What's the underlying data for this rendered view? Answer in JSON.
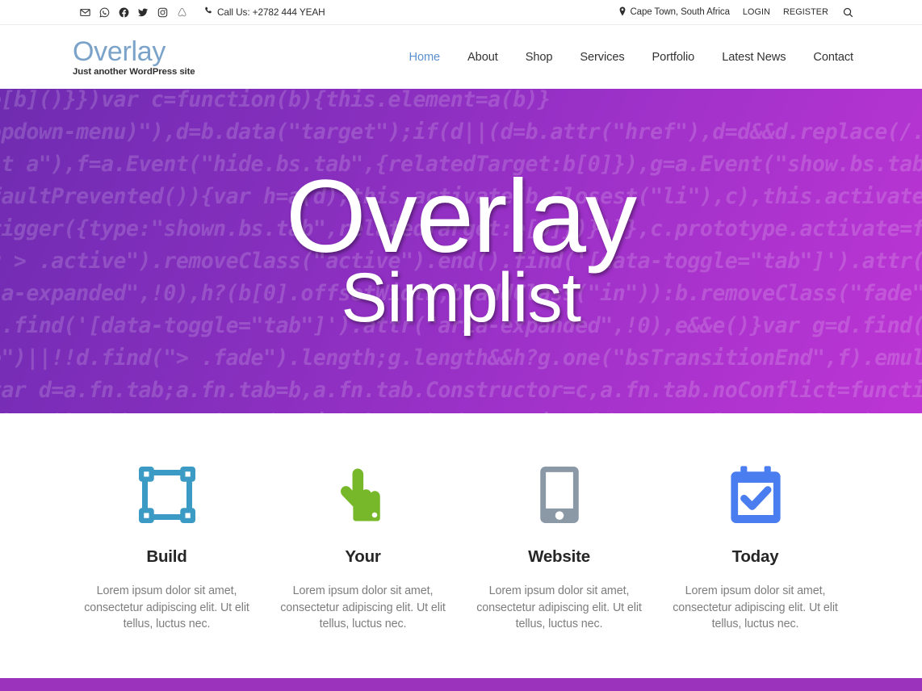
{
  "topbar": {
    "social": [
      {
        "name": "email-icon",
        "label": "Email"
      },
      {
        "name": "whatsapp-icon",
        "label": "WhatsApp"
      },
      {
        "name": "facebook-icon",
        "label": "Facebook"
      },
      {
        "name": "twitter-icon",
        "label": "Twitter"
      },
      {
        "name": "instagram-icon",
        "label": "Instagram"
      },
      {
        "name": "airbnb-icon",
        "label": "Airbnb"
      }
    ],
    "phone": "Call Us: +2782 444 YEAH",
    "location": "Cape Town, South Africa",
    "login": "LOGIN",
    "register": "REGISTER",
    "search_label": "Search"
  },
  "brand": {
    "title": "Overlay",
    "tagline": "Just another WordPress site",
    "color": "#7ba3c9"
  },
  "nav": {
    "items": [
      {
        "label": "Home",
        "active": true
      },
      {
        "label": "About",
        "active": false
      },
      {
        "label": "Shop",
        "active": false
      },
      {
        "label": "Services",
        "active": false
      },
      {
        "label": "Portfolio",
        "active": false
      },
      {
        "label": "Latest News",
        "active": false
      },
      {
        "label": "Contact",
        "active": false
      }
    ]
  },
  "hero": {
    "title": "Overlay",
    "subtitle": "Simplist",
    "gradient_from": "#6f2cb0",
    "gradient_to": "#bc35d4",
    "background_code": "e[b]()}})var c=function(b){this.element=a(b)}\nopdown-menu)\"),d=b.data(\"target\");if(d||(d=b.attr(\"href\"),d=d&&d.replace(/.*(?=#[^\\s]*$)/,\"\"))\nst a\"),f=a.Event(\"hide.bs.tab\",{relatedTarget:b[0]}),g=a.Event(\"show.bs.tab\",{relatedTarget:e[0]\nfaultPrevented()){var h=a(d);this.activate(b.closest(\"li\"),c),this.activate(h,h.parent(),functio\nrigger({type:\"shown.bs.tab\",relatedTarget:e[0]})})}},c.prototype.activate=function(b,d,e){func\nu > .active\").removeClass(\"active\").end().find('[data-toggle=\"tab\"]').attr(\"aria-expanded\",!1),\nia-expanded\",!0),h?(b[0].offsetWidth,b.addClass(\"in\")):b.removeClass(\"fade\"),b.parent(\".dropdo\n).find('[data-toggle=\"tab\"]').attr(\"aria-expanded\",!0),e&&e()}var g=d.find(\"> .active\"),h=e&&\ne\")||!!d.find(\"> .fade\").length;g.length&&h?g.one(\"bsTransitionEnd\",f).emulateTransitionEnd\nvar d=a.fn.tab;a.fn.tab=b,a.fn.tab.Constructor=c,a.fn.tab.noConflict=function(){return a.fn.t\nshow\")};a(document).on(\"click.bs.tab.data-api\",'[data-toggle=\"tab\"]',e).on(\"click.bs.tab.data\ne strict\";function b(b){return this.each(function(){var d=a(this),e=d.data(\"bs.affix\"),f=\"ob\ntypeof b&&e[b]()})}var c=function(b,d){this.options=a.extend({},c.DEFAULTS,d)"
  },
  "features": [
    {
      "icon": "vector-select-icon",
      "icon_color": "#3b9bc4",
      "title": "Build",
      "desc": "Lorem ipsum dolor sit amet, consectetur adipiscing elit. Ut elit tellus, luctus nec."
    },
    {
      "icon": "pointing-hand-icon",
      "icon_color": "#77b82a",
      "title": "Your",
      "desc": "Lorem ipsum dolor sit amet, consectetur adipiscing elit. Ut elit tellus, luctus nec."
    },
    {
      "icon": "tablet-icon",
      "icon_color": "#8b99a6",
      "title": "Website",
      "desc": "Lorem ipsum dolor sit amet, consectetur adipiscing elit. Ut elit tellus, luctus nec."
    },
    {
      "icon": "calendar-check-icon",
      "icon_color": "#4a7ef0",
      "title": "Today",
      "desc": "Lorem ipsum dolor sit amet, consectetur adipiscing elit. Ut elit tellus, luctus nec."
    }
  ],
  "footer": {
    "bar_color": "#9c33bd"
  }
}
